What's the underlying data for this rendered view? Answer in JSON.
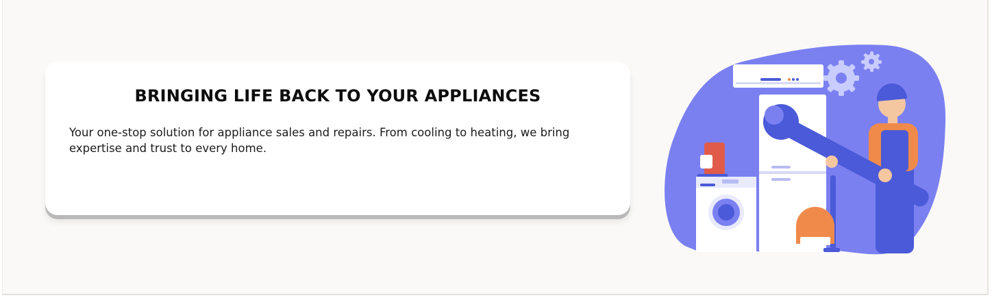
{
  "hero": {
    "title": "BRINGING LIFE BACK TO YOUR APPLIANCES",
    "description": "Your one-stop solution for appliance sales and repairs. From cooling to heating, we bring expertise and trust to every home."
  },
  "illustration": {
    "icon": "repair-technician-illustration",
    "colors": {
      "blob": "#7b80f1",
      "accent": "#4a5ad8",
      "orange": "#f08a4b",
      "skin": "#f5c7a0"
    }
  }
}
